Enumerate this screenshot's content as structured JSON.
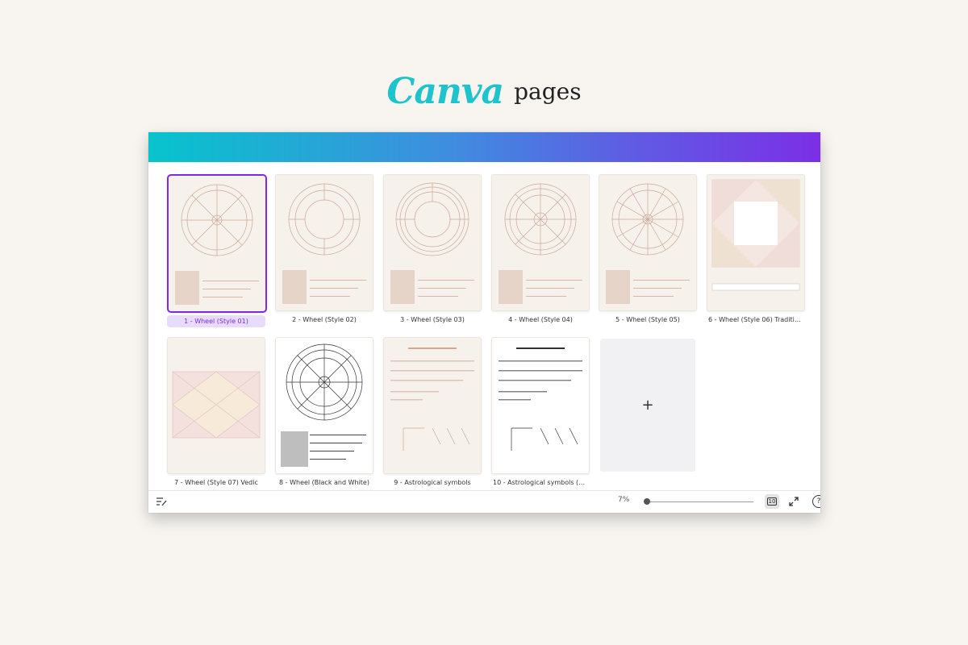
{
  "header": {
    "logo": "Canva",
    "subtitle": "pages"
  },
  "pages": [
    {
      "label": "1 - Wheel (Style 01)",
      "selected": true
    },
    {
      "label": "2 - Wheel (Style 02)"
    },
    {
      "label": "3 - Wheel (Style 03)"
    },
    {
      "label": "4 - Wheel (Style 04)"
    },
    {
      "label": "5 - Wheel (Style 05)"
    },
    {
      "label": "6 - Wheel (Style 06) Traditio..."
    },
    {
      "label": "7 - Wheel (Style 07) Vedic"
    },
    {
      "label": "8 - Wheel (Black and White)"
    },
    {
      "label": "9 - Astrological symbols"
    },
    {
      "label": "10 - Astrological symbols (Bl..."
    }
  ],
  "add_page": {
    "icon": "plus-icon",
    "symbol": "+"
  },
  "toolbar": {
    "zoom": "7%",
    "page_count": "10"
  },
  "colors": {
    "accent": "#7d2ae8",
    "brand": "#1ec3cc",
    "gradient_start": "#07c4cc",
    "gradient_end": "#7b2fe6"
  }
}
